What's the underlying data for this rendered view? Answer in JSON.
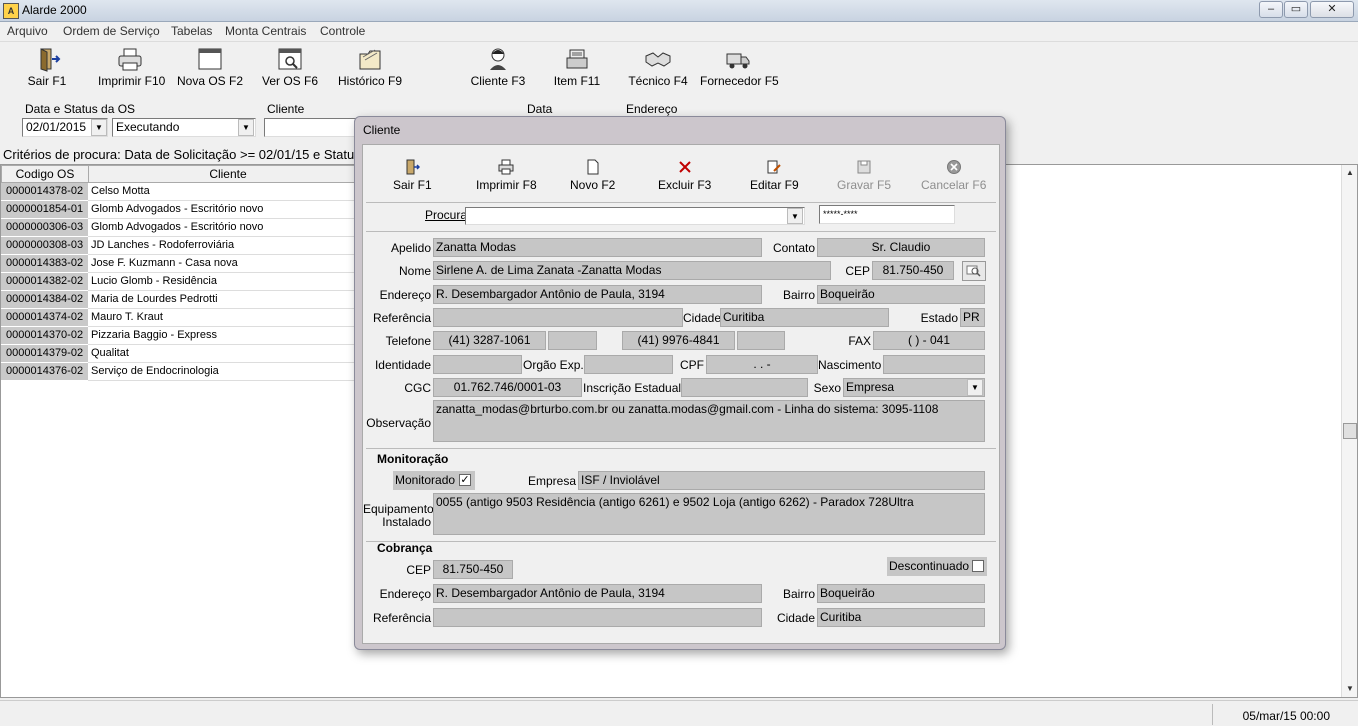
{
  "window": {
    "title": "Alarde 2000",
    "btn_min": "–",
    "btn_max": "▭",
    "btn_close": "✕"
  },
  "menu": [
    "Arquivo",
    "Ordem de Serviço",
    "Tabelas",
    "Monta Centrais",
    "Controle"
  ],
  "toolbar": {
    "sair": "Sair F1",
    "imprimir": "Imprimir F10",
    "nova_os": "Nova OS F2",
    "ver_os": "Ver OS F6",
    "historico": "Histórico F9",
    "cliente": "Cliente F3",
    "item": "Item F11",
    "tecnico": "Técnico F4",
    "fornecedor": "Fornecedor F5"
  },
  "filters": {
    "data_status_label": "Data e Status da OS",
    "date_value": "02/01/2015",
    "status_value": "Executando",
    "cliente_label": "Cliente",
    "data_label": "Data",
    "endereco_label": "Endereço"
  },
  "criteria_text": "Critérios de procura: Data de Solicitação >= 02/01/15 e Statu",
  "grid": {
    "headers": [
      "Codigo OS",
      "Cliente"
    ],
    "rows": [
      {
        "os": "0000014378-02",
        "cliente": "Celso Motta"
      },
      {
        "os": "0000001854-01",
        "cliente": "Glomb Advogados - Escritório novo"
      },
      {
        "os": "0000000306-03",
        "cliente": "Glomb Advogados - Escritório novo"
      },
      {
        "os": "0000000308-03",
        "cliente": "JD Lanches - Rodoferroviária"
      },
      {
        "os": "0000014383-02",
        "cliente": "Jose F. Kuzmann - Casa nova"
      },
      {
        "os": "0000014382-02",
        "cliente": "Lucio Glomb - Residência"
      },
      {
        "os": "0000014384-02",
        "cliente": "Maria de Lourdes Pedrotti"
      },
      {
        "os": "0000014374-02",
        "cliente": "Mauro T. Kraut"
      },
      {
        "os": "0000014370-02",
        "cliente": "Pizzaria Baggio - Express"
      },
      {
        "os": "0000014379-02",
        "cliente": "Qualitat"
      },
      {
        "os": "0000014376-02",
        "cliente": "Serviço de Endocrinologia"
      }
    ]
  },
  "status_bar": {
    "date": "05/mar/15  00:00"
  },
  "dialog": {
    "title": "Cliente",
    "buttons": {
      "sair": "Sair F1",
      "imprimir": "Imprimir F8",
      "novo": "Novo F2",
      "excluir": "Excluir F3",
      "editar": "Editar F9",
      "gravar": "Gravar F5",
      "cancelar": "Cancelar F6"
    },
    "procura_label": "Procura",
    "procura_value": "",
    "procura_mask": "*****-****",
    "labels": {
      "apelido": "Apelido",
      "contato": "Contato",
      "nome": "Nome",
      "cep": "CEP",
      "endereco": "Endereço",
      "bairro": "Bairro",
      "referencia": "Referência",
      "cidade": "Cidade",
      "estado": "Estado",
      "telefone": "Telefone",
      "fax": "FAX",
      "identidade": "Identidade",
      "orgao": "Orgão Exp.",
      "cpf": "CPF",
      "nascimento": "Nascimento",
      "cgc": "CGC",
      "inscricao": "Inscrição Estadual",
      "sexo": "Sexo",
      "observacao": "Observação",
      "monitoracao": "Monitoração",
      "monitorado": "Monitorado",
      "empresa": "Empresa",
      "equipamento_l1": "Equipamento",
      "equipamento_l2": "Instalado",
      "cobranca": "Cobrança",
      "descontinuado": "Descontinuado"
    },
    "values": {
      "apelido": "Zanatta Modas",
      "contato": "Sr. Claudio",
      "nome": "Sirlene A. de Lima Zanata -Zanatta Modas",
      "cep": "81.750-450",
      "endereco": "R. Desembargador Antônio de Paula, 3194",
      "bairro": "Boqueirão",
      "referencia": "",
      "cidade": "Curitiba",
      "estado": "PR",
      "telefone1": "(41) 3287-1061",
      "telefone2": "(41) 9976-4841",
      "fax": "(  )     - 041",
      "identidade": "",
      "orgao": "",
      "cpf": "  .    .   -",
      "nascimento": "",
      "cgc": "01.762.746/0001-03",
      "inscricao": "",
      "sexo": "Empresa",
      "observacao": "zanatta_modas@brturbo.com.br ou zanatta.modas@gmail.com - Linha do sistema: 3095-1108",
      "monitorado_check": "✓",
      "empresa": "ISF / Inviolável",
      "equipamento": "0055 (antigo 9503 Residência (antigo 6261) e 9502 Loja (antigo 6262) - Paradox 728Ultra",
      "cob_cep": "81.750-450",
      "cob_endereco": "R. Desembargador Antônio de Paula, 3194",
      "cob_bairro": "Boqueirão",
      "cob_referencia": "",
      "cob_cidade": "Curitiba"
    }
  }
}
